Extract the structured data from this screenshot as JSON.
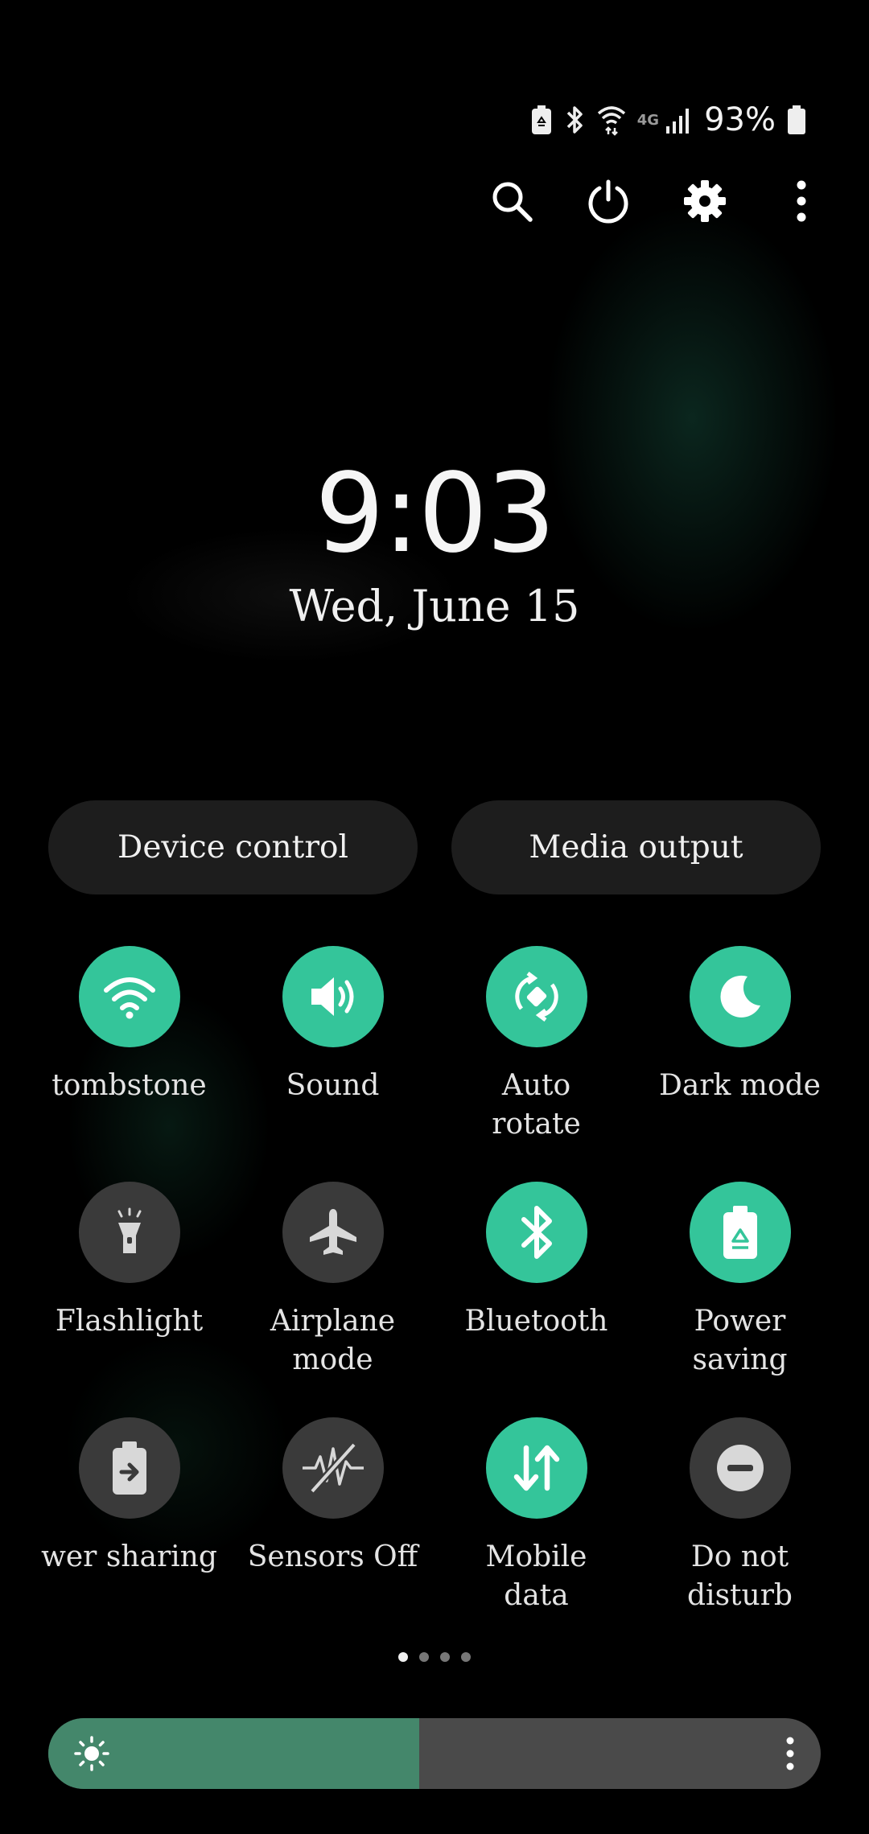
{
  "status_bar": {
    "network_type": "4G",
    "battery_percent": "93%"
  },
  "top_actions": [
    {
      "name": "search-icon"
    },
    {
      "name": "power-icon"
    },
    {
      "name": "settings-gear-icon"
    },
    {
      "name": "more-vert-icon"
    }
  ],
  "clock": {
    "time": "9:03",
    "date": "Wed, June 15"
  },
  "buttons": {
    "device_control": "Device control",
    "media_output": "Media output"
  },
  "tiles": [
    {
      "label": "tombstone",
      "state": "on",
      "icon": "wifi-icon"
    },
    {
      "label": "Sound",
      "state": "on",
      "icon": "sound-icon"
    },
    {
      "label": "Auto\nrotate",
      "state": "on",
      "icon": "auto-rotate-icon"
    },
    {
      "label": "Dark mode",
      "state": "on",
      "icon": "moon-icon"
    },
    {
      "label": "Flashlight",
      "state": "off",
      "icon": "flashlight-icon"
    },
    {
      "label": "Airplane\nmode",
      "state": "off",
      "icon": "airplane-icon"
    },
    {
      "label": "Bluetooth",
      "state": "on",
      "icon": "bluetooth-icon"
    },
    {
      "label": "Power\nsaving",
      "state": "on",
      "icon": "power-saving-icon"
    },
    {
      "label": "wer sharing",
      "state": "off",
      "icon": "wireless-power-sharing-icon"
    },
    {
      "label": "Sensors Off",
      "state": "off",
      "icon": "sensors-off-icon"
    },
    {
      "label": "Mobile\ndata",
      "state": "on",
      "icon": "mobile-data-icon"
    },
    {
      "label": "Do not\ndisturb",
      "state": "off",
      "icon": "do-not-disturb-icon"
    }
  ],
  "pagination": {
    "pages": 4,
    "current": 1
  },
  "brightness": {
    "level_fraction": 0.48
  },
  "colors": {
    "accent": "#34c59a",
    "tile_off": "#3a3a3a",
    "brightness_fill": "#44876b"
  }
}
